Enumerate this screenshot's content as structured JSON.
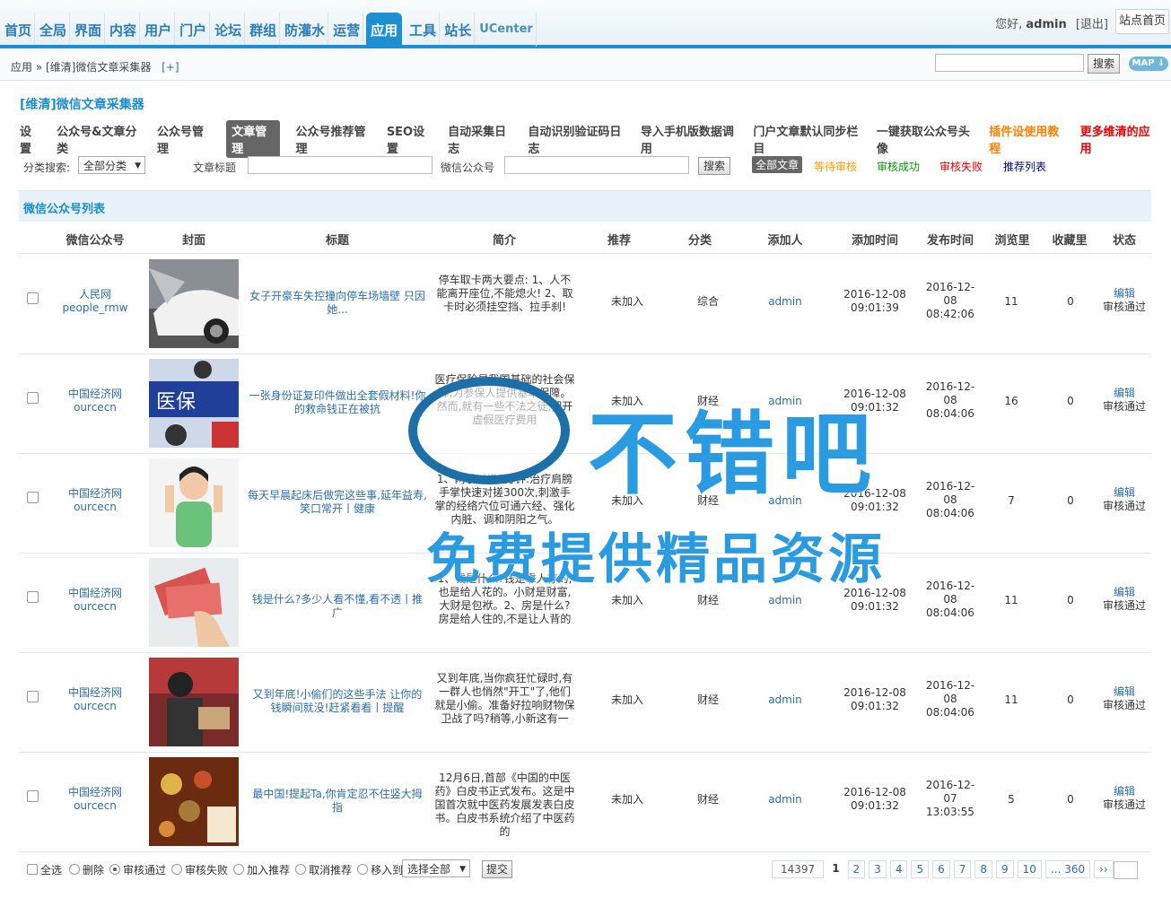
{
  "nav": {
    "items": [
      "首页",
      "全局",
      "界面",
      "内容",
      "用户",
      "门户",
      "论坛",
      "群组",
      "防灌水",
      "运营",
      "应用",
      "工具",
      "站长",
      "UCenter"
    ],
    "active_index": 10
  },
  "user": {
    "greeting": "您好,",
    "name": "admin",
    "logout": "[退出]",
    "site_home": "站点首页"
  },
  "breadcrumb": {
    "path": "应用 » [维清]微信文章采集器",
    "plus": "[+]"
  },
  "topsearch": {
    "button": "搜索",
    "map": "MAP ↓"
  },
  "page_title": "[维清]微信文章采集器",
  "tabs": [
    {
      "label": "设置",
      "style": ""
    },
    {
      "label": "公众号&文章分类",
      "style": ""
    },
    {
      "label": "公众号管理",
      "style": ""
    },
    {
      "label": "文章管理",
      "style": "active"
    },
    {
      "label": "公众号推荐管理",
      "style": ""
    },
    {
      "label": "SEO设置",
      "style": ""
    },
    {
      "label": "自动采集日志",
      "style": ""
    },
    {
      "label": "自动识别验证码日志",
      "style": ""
    },
    {
      "label": "导入手机版数据调用",
      "style": ""
    },
    {
      "label": "门户文章默认同步栏目",
      "style": ""
    },
    {
      "label": "一键获取公众号头像",
      "style": ""
    },
    {
      "label": "插件设使用教程",
      "style": "orange"
    },
    {
      "label": "更多维清的应用",
      "style": "red"
    }
  ],
  "filter": {
    "category_label": "分类搜索:",
    "category_value": "全部分类",
    "title_label": "文章标题",
    "account_label": "微信公众号",
    "search_button": "搜索",
    "status_links": [
      {
        "label": "全部文章",
        "color": "#ffffff"
      },
      {
        "label": "等待审核",
        "color": "#ff9900"
      },
      {
        "label": "审核成功",
        "color": "#009900"
      },
      {
        "label": "审核失败",
        "color": "#dd0000"
      },
      {
        "label": "推荐列表",
        "color": "#000080"
      }
    ]
  },
  "table": {
    "section_title": "微信公众号列表",
    "columns": [
      "微信公众号",
      "封面",
      "标题",
      "简介",
      "推荐",
      "分类",
      "添加人",
      "添加时间",
      "发布时间",
      "浏览里",
      "收藏里",
      "状态"
    ],
    "rows": [
      {
        "account": "人民网",
        "account_id": "people_rmw",
        "title": "女子开豪车失控撞向停车场墙壁 只因她...",
        "intro": "停车取卡两大要点: 1、人不能离开座位,不能熄火! 2、取卡时必须挂空挡、拉手刹!",
        "recommend": "未加入",
        "category": "综合",
        "adder": "admin",
        "add_time": "2016-12-08 09:01:39",
        "pub_time": "2016-12-08 08:42:06",
        "views": "11",
        "favs": "0",
        "edit": "编辑",
        "status": "审核通过",
        "cover": "car"
      },
      {
        "account": "中国经济网",
        "account_id": "ourcecn",
        "title": "一张身份证复印件做出全套假材料!你的救命钱正在被抗",
        "intro": "医疗保险是我国基础的社会保障,为参保人提供基本保障。然而,就有一些不法之徒,把开虚假医疗费用",
        "recommend": "未加入",
        "category": "财经",
        "adder": "admin",
        "add_time": "2016-12-08 09:01:32",
        "pub_time": "2016-12-08 08:04:06",
        "views": "16",
        "favs": "0",
        "edit": "编辑",
        "status": "审核通过",
        "cover": "hospital"
      },
      {
        "account": "中国经济网",
        "account_id": "ourcecn",
        "title": "每天早晨起床后做完这些事,延年益寿,笑口常开丨健康",
        "intro": "1、两手对搓1分钟:治疗肩膀手掌快速对搓300次,刺激手掌的经络穴位可通六经、强化内脏、调和阴阳之气。",
        "recommend": "未加入",
        "category": "财经",
        "adder": "admin",
        "add_time": "2016-12-08 09:01:32",
        "pub_time": "2016-12-08 08:04:06",
        "views": "7",
        "favs": "0",
        "edit": "编辑",
        "status": "审核通过",
        "cover": "woman"
      },
      {
        "account": "中国经济网",
        "account_id": "ourcecn",
        "title": "钱是什么?多少人看不懂,看不透丨推广",
        "intro": "1、钱是什么?钱是靠人存的,也是给人花的。小财是财富,大财是包袱。2、房是什么?房是给人住的,不是让人背的",
        "recommend": "未加入",
        "category": "财经",
        "adder": "admin",
        "add_time": "2016-12-08 09:01:32",
        "pub_time": "2016-12-08 08:04:06",
        "views": "11",
        "favs": "0",
        "edit": "编辑",
        "status": "审核通过",
        "cover": "money"
      },
      {
        "account": "中国经济网",
        "account_id": "ourcecn",
        "title": "又到年底!小偷们的这些手法 让你的钱瞬间就没!赶紧看看丨提醒",
        "intro": "又到年底,当你疯狂忙碌时,有一群人也悄然\"开工\"了,他们就是小偷。准备好拉响财物保卫战了吗?稍等,小新这有一",
        "recommend": "未加入",
        "category": "财经",
        "adder": "admin",
        "add_time": "2016-12-08 09:01:32",
        "pub_time": "2016-12-08 08:04:06",
        "views": "11",
        "favs": "0",
        "edit": "编辑",
        "status": "审核通过",
        "cover": "thief"
      },
      {
        "account": "中国经济网",
        "account_id": "ourcecn",
        "title": "最中国!提起Ta,你肯定忍不住竖大拇指",
        "intro": "12月6日,首部《中国的中医药》白皮书正式发布。这是中国首次就中医药发展发表白皮书。白皮书系统介绍了中医药的",
        "recommend": "未加入",
        "category": "财经",
        "adder": "admin",
        "add_time": "2016-12-08 09:01:32",
        "pub_time": "2016-12-07 13:03:55",
        "views": "5",
        "favs": "0",
        "edit": "编辑",
        "status": "审核通过",
        "cover": "herbs"
      }
    ]
  },
  "bottom": {
    "select_all": "全选",
    "options": [
      {
        "label": "删除",
        "checked": false
      },
      {
        "label": "审核通过",
        "checked": true
      },
      {
        "label": "审核失败",
        "checked": false
      },
      {
        "label": "加入推荐",
        "checked": false
      },
      {
        "label": "取消推荐",
        "checked": false
      },
      {
        "label": "移入到",
        "checked": false
      }
    ],
    "move_select": "选择全部",
    "submit": "提交"
  },
  "pager": {
    "total": "14397",
    "current": "1",
    "pages": [
      "2",
      "3",
      "4",
      "5",
      "6",
      "7",
      "8",
      "9",
      "10",
      "... 360",
      "››"
    ]
  },
  "watermark": {
    "line1": "不错吧",
    "line2": "免费提供精品资源"
  }
}
